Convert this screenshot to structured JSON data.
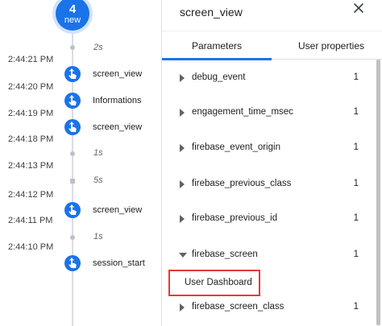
{
  "badge": {
    "count": "4",
    "label": "new"
  },
  "timeline": {
    "times": [
      "2:44:21 PM",
      "2:44:20 PM",
      "2:44:19 PM",
      "2:44:18 PM",
      "2:44:13 PM",
      "2:44:12 PM",
      "2:44:11 PM",
      "2:44:10 PM"
    ],
    "events": [
      "screen_view",
      "Informations",
      "screen_view",
      "screen_view",
      "session_start"
    ],
    "gaps": [
      "2s",
      "1s",
      "5s",
      "1s"
    ]
  },
  "panel": {
    "title": "screen_view",
    "tabs": [
      "Parameters",
      "User properties"
    ],
    "params": [
      {
        "name": "debug_event",
        "count": "1"
      },
      {
        "name": "engagement_time_msec",
        "count": "1"
      },
      {
        "name": "firebase_event_origin",
        "count": "1"
      },
      {
        "name": "firebase_previous_class",
        "count": "1"
      },
      {
        "name": "firebase_previous_id",
        "count": "1"
      },
      {
        "name": "firebase_screen",
        "count": "1"
      },
      {
        "name": "firebase_screen_class",
        "count": "1"
      }
    ],
    "expanded_value": "User Dashboard"
  },
  "colors": {
    "accent": "#1a73e8",
    "highlight": "#e53935"
  }
}
